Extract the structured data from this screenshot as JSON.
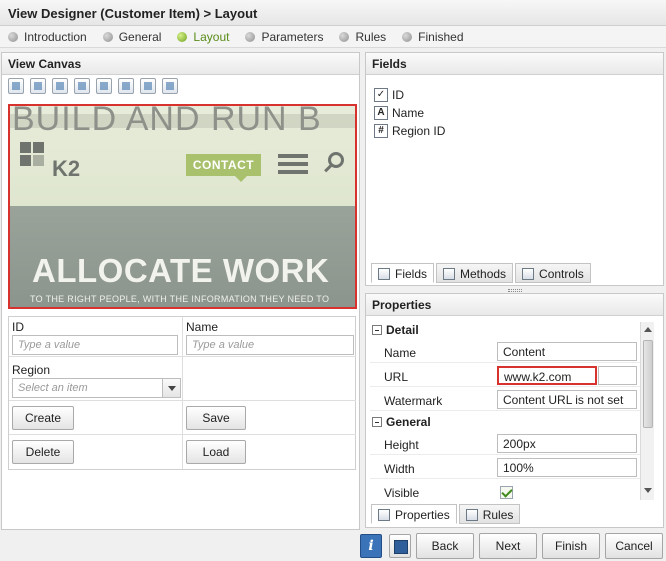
{
  "window": {
    "title": "View Designer (Customer Item) > Layout"
  },
  "steps": [
    {
      "label": "Introduction",
      "active": false
    },
    {
      "label": "General",
      "active": false
    },
    {
      "label": "Layout",
      "active": true
    },
    {
      "label": "Parameters",
      "active": false
    },
    {
      "label": "Rules",
      "active": false
    },
    {
      "label": "Finished",
      "active": false
    }
  ],
  "canvas": {
    "title": "View Canvas",
    "image": {
      "banner_text": "BUILD AND RUN B",
      "logo_text": "K2",
      "contact_label": "CONTACT",
      "hero_title": "ALLOCATE WORK",
      "hero_subtitle": "TO THE RIGHT PEOPLE, WITH THE INFORMATION THEY NEED TO"
    },
    "form": {
      "id_label": "ID",
      "id_placeholder": "Type a value",
      "name_label": "Name",
      "name_placeholder": "Type a value",
      "region_label": "Region",
      "region_placeholder": "Select an item",
      "buttons": {
        "create": "Create",
        "save": "Save",
        "delete": "Delete",
        "load": "Load"
      }
    }
  },
  "fields": {
    "title": "Fields",
    "items": [
      {
        "label": "ID",
        "icon": "key-field-icon"
      },
      {
        "label": "Name",
        "icon": "text-field-icon"
      },
      {
        "label": "Region ID",
        "icon": "number-field-icon"
      }
    ],
    "tabs": [
      "Fields",
      "Methods",
      "Controls"
    ]
  },
  "properties": {
    "title": "Properties",
    "groups": {
      "detail": {
        "label": "Detail",
        "rows": {
          "name": {
            "label": "Name",
            "value": "Content"
          },
          "url": {
            "label": "URL",
            "value": "www.k2.com"
          },
          "watermark": {
            "label": "Watermark",
            "value": "Content URL is not set"
          }
        }
      },
      "general": {
        "label": "General",
        "rows": {
          "height": {
            "label": "Height",
            "value": "200px"
          },
          "width": {
            "label": "Width",
            "value": "100%"
          },
          "visible": {
            "label": "Visible"
          }
        }
      }
    },
    "tabs": [
      "Properties",
      "Rules"
    ]
  },
  "footer": {
    "info": "i",
    "back": "Back",
    "next": "Next",
    "finish": "Finish",
    "cancel": "Cancel"
  },
  "colors": {
    "accent_green": "#6ea21d",
    "highlight_red": "#d8322f",
    "info_blue": "#3a73b8"
  }
}
